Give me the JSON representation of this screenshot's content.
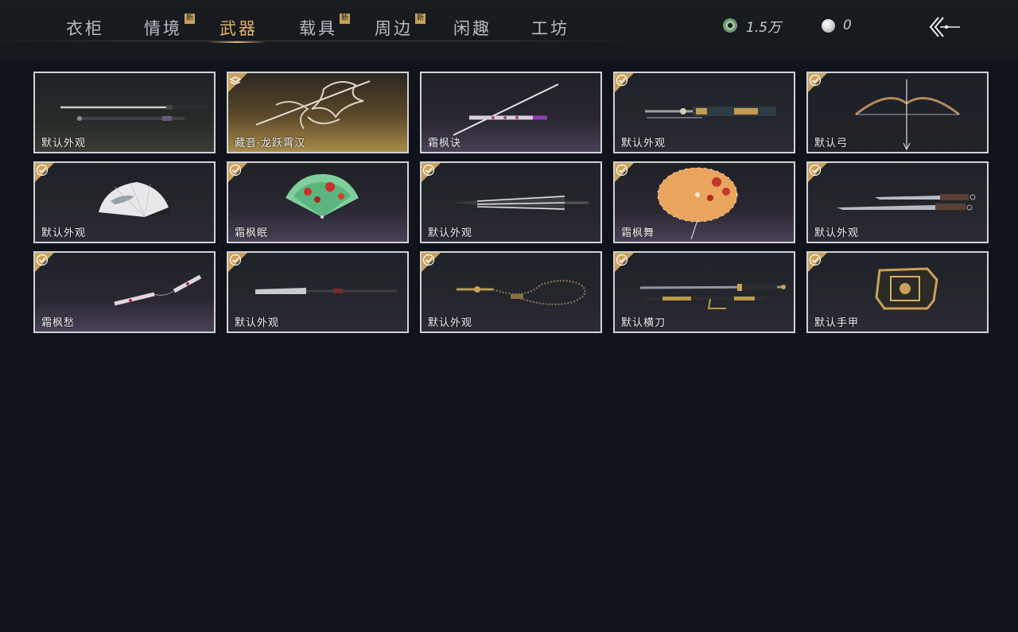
{
  "tabs": [
    {
      "label": "衣柜",
      "new": false,
      "active": false
    },
    {
      "label": "情境",
      "new": true,
      "active": false
    },
    {
      "label": "武器",
      "new": false,
      "active": true
    },
    {
      "label": "载具",
      "new": true,
      "active": false
    },
    {
      "label": "周边",
      "new": true,
      "active": false
    },
    {
      "label": "闲趣",
      "new": false,
      "active": false
    },
    {
      "label": "工坊",
      "new": false,
      "active": false
    }
  ],
  "new_badge": "新",
  "currency": {
    "jade": {
      "icon": "jade-coin-icon",
      "amount": "1.5万"
    },
    "pearl": {
      "icon": "pearl-icon",
      "amount": "0"
    }
  },
  "back_icon": "back-arrow-icon",
  "items": [
    {
      "label": "默认外观",
      "corner": "none",
      "art": "sword-pair"
    },
    {
      "label": "藏音·龙跃霄汉",
      "corner": "layers",
      "art": "dragon-spear"
    },
    {
      "label": "霜枫诀",
      "corner": "none",
      "art": "sword-sheath"
    },
    {
      "label": "默认外观",
      "corner": "check",
      "art": "ornate-sword"
    },
    {
      "label": "默认弓",
      "corner": "check",
      "art": "bow"
    },
    {
      "label": "默认外观",
      "corner": "check",
      "art": "white-fan"
    },
    {
      "label": "霜枫眠",
      "corner": "check",
      "art": "green-fan"
    },
    {
      "label": "默认外观",
      "corner": "check",
      "art": "umbrella-closed"
    },
    {
      "label": "霜枫舞",
      "corner": "check",
      "art": "umbrella-open"
    },
    {
      "label": "默认外观",
      "corner": "check",
      "art": "dual-blades"
    },
    {
      "label": "霜枫愁",
      "corner": "check",
      "art": "nunchaku"
    },
    {
      "label": "默认外观",
      "corner": "check",
      "art": "glaive"
    },
    {
      "label": "默认外观",
      "corner": "check",
      "art": "rope-dart"
    },
    {
      "label": "默认横刀",
      "corner": "check",
      "art": "hengdao"
    },
    {
      "label": "默认手甲",
      "corner": "check",
      "art": "gauntlet"
    }
  ],
  "colors": {
    "accent": "#e3b36a",
    "badge": "#c9a15a",
    "background": "#10141a",
    "card_border": "#cfd2d6"
  }
}
